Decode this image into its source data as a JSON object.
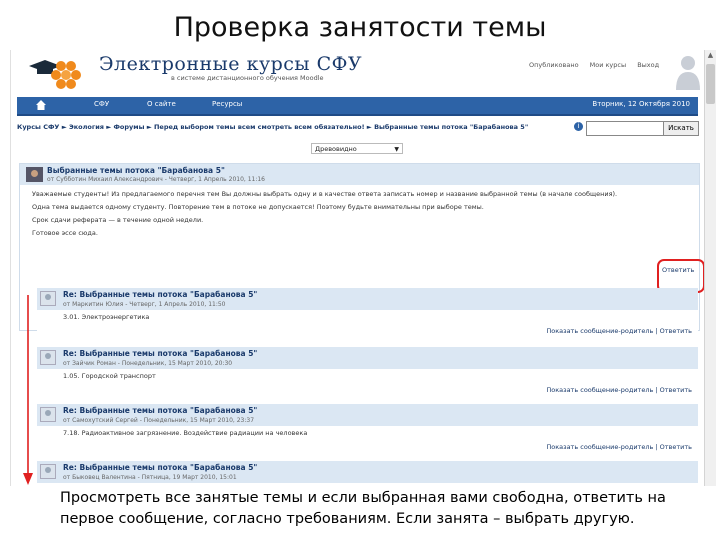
{
  "slide": {
    "title": "Проверка занятости темы",
    "caption_line1": "Просмотреть все занятые темы и если выбранная вами свободна, ответить на",
    "caption_line2": "первое сообщение, согласно требованиям. Если занята – выбрать другую."
  },
  "header": {
    "site_title": "Электронные курсы СФУ",
    "site_subtitle": "в системе дистанционного обучения Moodle",
    "links": [
      "Опубликовано",
      "Мои курсы",
      "Выход"
    ]
  },
  "navbar": {
    "home_icon": "home-icon",
    "items": [
      "СФУ",
      "О сайте",
      "Ресурсы"
    ],
    "date": "Вторник, 12 Октября 2010"
  },
  "breadcrumb": "Курсы СФУ ► Экология ► Форумы ► Перед выбором темы всем смотреть всем обязательно! ► Выбранные темы потока \"Барабанова 5\"",
  "search": {
    "placeholder": "",
    "button": "Искать"
  },
  "display_mode": "Древовидно",
  "main_post": {
    "title": "Выбранные темы потока \"Барабанова 5\"",
    "meta": "от Субботин Михаил Александрович - Четверг, 1 Апрель 2010, 11:16",
    "body": [
      "Уважаемые студенты! Из предлагаемого перечня тем Вы должны выбрать одну и в качестве ответа записать номер и название выбранной темы (в начале сообщения).",
      "Одна тема выдается одному студенту. Повторение тем в потоке не допускается! Поэтому будьте внимательны при выборе темы.",
      "Срок сдачи реферата — в течение одной недели.",
      "Готовое эссе сюда."
    ],
    "reply_label": "Ответить"
  },
  "replies": [
    {
      "title": "Re: Выбранные темы потока \"Барабанова 5\"",
      "meta": "от Маркитин Юлия - Четверг, 1 Апрель 2010, 11:50",
      "body": "3.01. Электроэнергетика",
      "links": "Показать сообщение-родитель | Ответить"
    },
    {
      "title": "Re: Выбранные темы потока \"Барабанова 5\"",
      "meta": "от Зайчик Роман - Понедельник, 15 Март 2010, 20:30",
      "body": "1.05. Городской транспорт",
      "links": "Показать сообщение-родитель | Ответить"
    },
    {
      "title": "Re: Выбранные темы потока \"Барабанова 5\"",
      "meta": "от Самохутский Сергей - Понедельник, 15 Март 2010, 23:37",
      "body": "7.18. Радиоактивное загрязнение. Воздействие радиации на человека",
      "links": "Показать сообщение-родитель | Ответить"
    },
    {
      "title": "Re: Выбранные темы потока \"Барабанова 5\"",
      "meta": "от Быковец Валентина - Пятница, 19 Март 2010, 15:01",
      "body": "",
      "links": ""
    }
  ],
  "colors": {
    "navbar": "#2d63a7",
    "post_header": "#dbe7f3",
    "highlight": "#e02020"
  }
}
